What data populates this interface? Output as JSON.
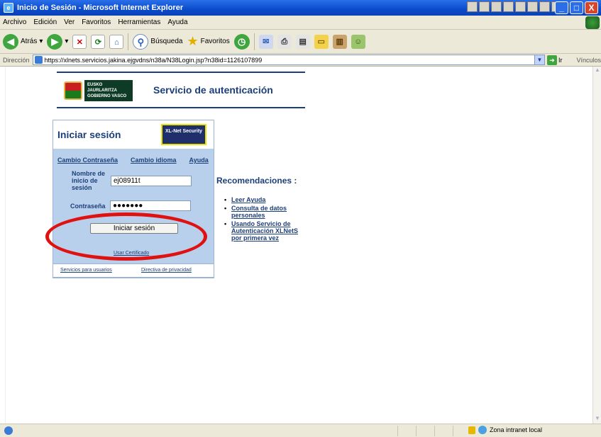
{
  "window": {
    "title": "Inicio de Sesión - Microsoft Internet Explorer",
    "buttons": [
      "_",
      "□",
      "X"
    ]
  },
  "menu": [
    "Archivo",
    "Edición",
    "Ver",
    "Favoritos",
    "Herramientas",
    "Ayuda"
  ],
  "toolbar": {
    "back": "Atrás",
    "search": "Búsqueda",
    "favorites": "Favoritos"
  },
  "address": {
    "label": "Dirección",
    "url": "https://xlnets.servicios.jakina.ejgvdns/n38a/N38Login.jsp?n38id=1126107899",
    "go": "Ir",
    "links": "Vínculos"
  },
  "page": {
    "logo_text": "EUSKO JAURLARITZA GOBIERNO VASCO",
    "service_title": "Servicio de autenticación",
    "login": {
      "title": "Iniciar sesión",
      "badge": "XL-Net Security",
      "link_password": "Cambio Contraseña",
      "link_language": "Cambio idioma",
      "link_help": "Ayuda",
      "user_label": "Nombre de inicio de sesión",
      "user_value": "ej08911t",
      "password_label": "Contraseña",
      "password_value": "●●●●●●●",
      "submit": "Iniciar sesión",
      "certificate": "Usar Certificado"
    },
    "footer": {
      "services": "Servicios para usuarios",
      "privacy": "Directiva de privacidad"
    },
    "recommendations": {
      "title": "Recomendaciones :",
      "items": [
        "Leer Ayuda",
        "Consulta de datos personales",
        "Usando Servicio de Autenticación XLNetS por primera vez"
      ]
    }
  },
  "status": {
    "zone": "Zona intranet local"
  },
  "colors": {
    "accent": "#1c3f7a",
    "panel": "#b9d0ec",
    "highlight": "#e01111"
  }
}
